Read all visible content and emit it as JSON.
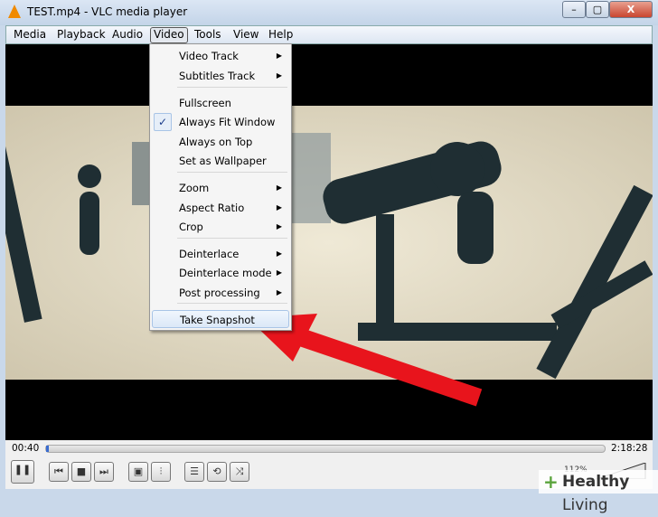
{
  "window": {
    "title": "TEST.mp4 - VLC media player",
    "minimize": "–",
    "maximize": "▢",
    "close": "X"
  },
  "menubar": [
    "Media",
    "Playback",
    "Audio",
    "Video",
    "Tools",
    "View",
    "Help"
  ],
  "video_menu": {
    "items": [
      {
        "label": "Video Track",
        "submenu": true
      },
      {
        "label": "Subtitles Track",
        "submenu": true
      },
      {
        "label": "Fullscreen"
      },
      {
        "label": "Always Fit Window",
        "checked": true
      },
      {
        "label": "Always on Top"
      },
      {
        "label": "Set as Wallpaper"
      },
      {
        "label": "Zoom",
        "submenu": true
      },
      {
        "label": "Aspect Ratio",
        "submenu": true
      },
      {
        "label": "Crop",
        "submenu": true
      },
      {
        "label": "Deinterlace",
        "submenu": true
      },
      {
        "label": "Deinterlace mode",
        "submenu": true
      },
      {
        "label": "Post processing",
        "submenu": true
      },
      {
        "label": "Take Snapshot",
        "highlighted": true
      }
    ],
    "arrow": "▶",
    "check": "✓"
  },
  "player": {
    "elapsed": "00:40",
    "duration": "2:18:28",
    "progress": 0.005,
    "volume": "112%"
  },
  "controls": {
    "pause": "❚❚",
    "prev": "⏮",
    "stop": "■",
    "next": "⏭",
    "fullscreen": "▣",
    "equalizer": "⫶",
    "playlist": "☰",
    "loop": "⟲",
    "shuffle": "⤨"
  },
  "watermark": {
    "healthy": "Healthy",
    "living": " Living",
    "plus": "+"
  },
  "colors": {
    "arrow": "#e8141c",
    "highlight": "#dbe8f7"
  }
}
